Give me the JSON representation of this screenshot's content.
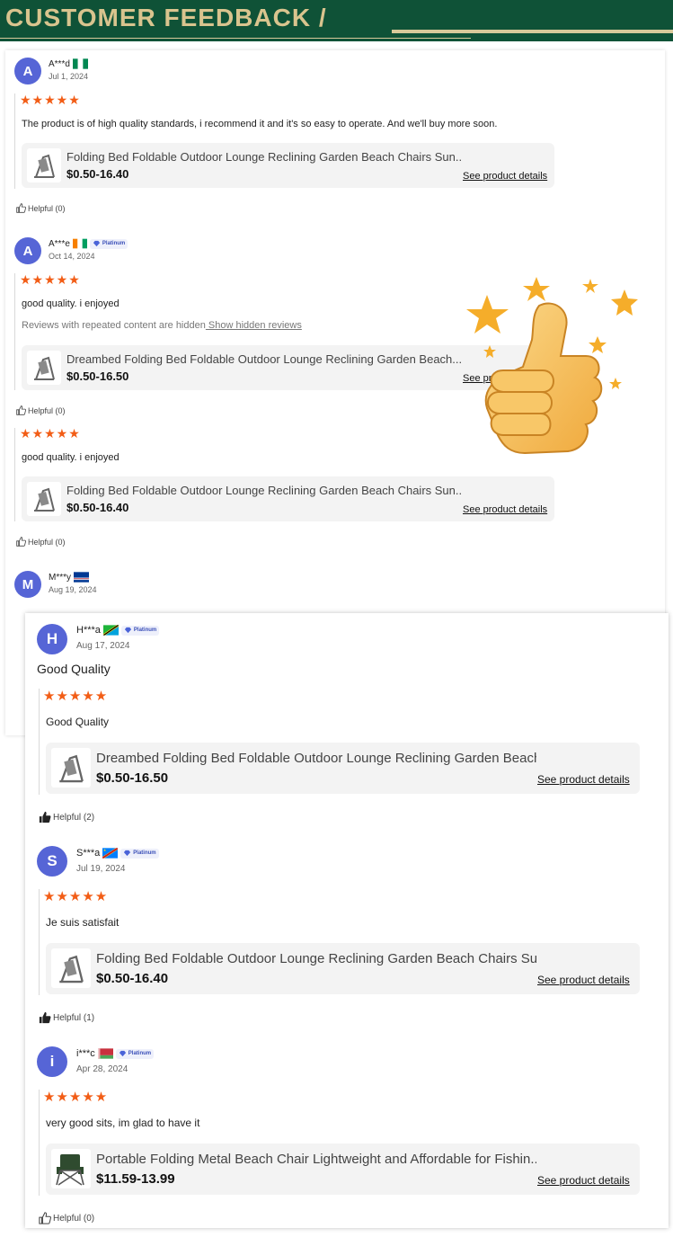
{
  "banner": {
    "title": "CUSTOMER FEEDBACK /"
  },
  "colors": {
    "banner_bg": "#0f5237",
    "banner_text": "#d9c48e",
    "star": "#f25d16",
    "avatar": "#5665d6"
  },
  "back_reviews": [
    {
      "initial": "A",
      "name": "A***d",
      "date": "Jul 1, 2024",
      "flag": "nigeria-flag",
      "platinum": false,
      "stars": "★★★★★",
      "text": "The product is of high quality standards, i recommend it and it's so easy to operate. And we'll buy more soon.",
      "product": {
        "name": "Folding Bed Foldable Outdoor Lounge Reclining Garden Beach Chairs Sun...",
        "price": "$0.50-16.40",
        "link": "See product details"
      },
      "helpful": "Helpful (0)"
    },
    {
      "initial": "A",
      "name": "A***e",
      "date": "Oct 14, 2024",
      "flag": "ivory-coast-flag",
      "platinum": true,
      "platinum_label": "Platinum",
      "stars": "★★★★★",
      "text": "good quality. i enjoyed",
      "hidden_note": "Reviews with repeated content are hidden",
      "hidden_link": " Show hidden reviews",
      "product": {
        "name": "Dreambed Folding Bed Foldable Outdoor Lounge Reclining Garden Beach...",
        "price": "$0.50-16.50",
        "link": "See product details"
      },
      "helpful": "Helpful (0)"
    },
    {
      "stars": "★★★★★",
      "text": "good quality. i enjoyed",
      "product": {
        "name": "Folding Bed Foldable Outdoor Lounge Reclining Garden Beach Chairs Sun...",
        "price": "$0.50-16.40",
        "link": "See product details"
      },
      "helpful": "Helpful (0)"
    },
    {
      "initial": "M",
      "name": "M***y",
      "date": "Aug 19, 2024",
      "flag": "cape-verde-flag",
      "platinum": false
    }
  ],
  "front_reviews": [
    {
      "initial": "H",
      "name": "H***a",
      "date": "Aug 17, 2024",
      "flag": "tanzania-flag",
      "platinum": true,
      "platinum_label": "Platinum",
      "headline": "Good Quality",
      "stars": "★★★★★",
      "text": "Good Quality",
      "product": {
        "name": "Dreambed Folding Bed Foldable Outdoor Lounge Reclining Garden Beach...",
        "price": "$0.50-16.50",
        "link": "See product details"
      },
      "helpful": "Helpful (2)",
      "helpful_filled": true
    },
    {
      "initial": "S",
      "name": "S***a",
      "date": "Jul 19, 2024",
      "flag": "dr-congo-flag",
      "platinum": true,
      "platinum_label": "Platinum",
      "stars": "★★★★★",
      "text": "Je suis satisfait",
      "product": {
        "name": "Folding Bed Foldable Outdoor Lounge Reclining Garden Beach Chairs Sun...",
        "price": "$0.50-16.40",
        "link": "See product details"
      },
      "helpful": "Helpful (1)",
      "helpful_filled": true
    },
    {
      "initial": "i",
      "name": "i***c",
      "date": "Apr 28, 2024",
      "flag": "belarus-flag",
      "platinum": true,
      "platinum_label": "Platinum",
      "stars": "★★★★★",
      "text": "very good sits, im glad to have it",
      "product": {
        "name": "Portable Folding Metal Beach Chair Lightweight and Affordable for Fishin...",
        "price": "$11.59-13.99",
        "link": "See product details"
      },
      "helpful": "Helpful (0)",
      "helpful_filled": false
    }
  ]
}
